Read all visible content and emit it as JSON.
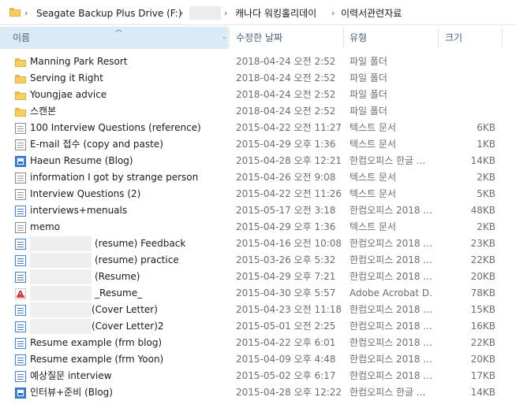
{
  "breadcrumb": {
    "drive": "Seagate Backup Plus Drive (F:)",
    "folder1": "캐나다 워킹홀리데이",
    "folder2": "이력서관련자료"
  },
  "columns": {
    "name": "이름",
    "modified": "수정한 날짜",
    "type": "유형",
    "size": "크기"
  },
  "files": [
    {
      "name": "Manning Park Resort",
      "date": "2018-04-24 오전 2:52",
      "type": "파일 폴더",
      "size": "",
      "icon": "folder-icon",
      "kind": "folder"
    },
    {
      "name": "Serving it Right",
      "date": "2018-04-24 오전 2:52",
      "type": "파일 폴더",
      "size": "",
      "icon": "folder-icon",
      "kind": "folder"
    },
    {
      "name": "Youngjae advice",
      "date": "2018-04-24 오전 2:52",
      "type": "파일 폴더",
      "size": "",
      "icon": "folder-icon",
      "kind": "folder"
    },
    {
      "name": "스캔본",
      "date": "2018-04-24 오전 2:52",
      "type": "파일 폴더",
      "size": "",
      "icon": "folder-icon",
      "kind": "folder"
    },
    {
      "name": "100 Interview Questions (reference)",
      "date": "2015-04-22 오전 11:27",
      "type": "텍스트 문서",
      "size": "6KB",
      "icon": "text-file-icon",
      "kind": "text"
    },
    {
      "name": "E-mail 접수 (copy and paste)",
      "date": "2015-04-29 오후 1:36",
      "type": "텍스트 문서",
      "size": "1KB",
      "icon": "text-file-icon",
      "kind": "text"
    },
    {
      "name": "Haeun Resume (Blog)",
      "date": "2015-04-28 오후 12:21",
      "type": "한컴오피스 한글 ...",
      "size": "14KB",
      "icon": "hwp-image-file-icon",
      "kind": "hwpimg"
    },
    {
      "name": "information I got by strange person",
      "date": "2015-04-26 오전 9:08",
      "type": "텍스트 문서",
      "size": "2KB",
      "icon": "text-file-icon",
      "kind": "text"
    },
    {
      "name": "Interview Questions (2)",
      "date": "2015-04-22 오전 11:26",
      "type": "텍스트 문서",
      "size": "5KB",
      "icon": "text-file-icon",
      "kind": "text"
    },
    {
      "name": "interviews+menuals",
      "date": "2015-05-17 오전 3:18",
      "type": "한컴오피스 2018 ...",
      "size": "48KB",
      "icon": "hwp-file-icon",
      "kind": "hwp"
    },
    {
      "name": "memo",
      "date": "2015-04-29 오후 1:36",
      "type": "텍스트 문서",
      "size": "2KB",
      "icon": "text-file-icon",
      "kind": "text"
    },
    {
      "name": "(resume) Feedback",
      "date": "2015-04-16 오전 10:08",
      "type": "한컴오피스 2018 ...",
      "size": "23KB",
      "icon": "hwp-file-icon",
      "kind": "hwp",
      "redacted": true
    },
    {
      "name": "(resume) practice",
      "date": "2015-03-26 오후 5:32",
      "type": "한컴오피스 2018 ...",
      "size": "22KB",
      "icon": "hwp-file-icon",
      "kind": "hwp",
      "redacted": true
    },
    {
      "name": "(Resume)",
      "date": "2015-04-29 오후 7:21",
      "type": "한컴오피스 2018 ...",
      "size": "20KB",
      "icon": "hwp-file-icon",
      "kind": "hwp",
      "redacted": true
    },
    {
      "name": "_Resume_",
      "date": "2015-04-30 오후 5:57",
      "type": "Adobe Acrobat D...",
      "size": "78KB",
      "icon": "pdf-file-icon",
      "kind": "pdf",
      "redacted": true
    },
    {
      "name": "(Cover Letter)",
      "date": "2015-04-23 오전 11:18",
      "type": "한컴오피스 2018 ...",
      "size": "15KB",
      "icon": "hwp-file-icon",
      "kind": "hwp",
      "redacted": true
    },
    {
      "name": "(Cover Letter)2",
      "date": "2015-05-01 오전 2:25",
      "type": "한컴오피스 2018 ...",
      "size": "16KB",
      "icon": "hwp-file-icon",
      "kind": "hwp",
      "redacted": true
    },
    {
      "name": "Resume example (frm blog)",
      "date": "2015-04-22 오후 6:01",
      "type": "한컴오피스 2018 ...",
      "size": "22KB",
      "icon": "hwp-file-icon",
      "kind": "hwp"
    },
    {
      "name": "Resume example (frm Yoon)",
      "date": "2015-04-09 오후 4:48",
      "type": "한컴오피스 2018 ...",
      "size": "20KB",
      "icon": "hwp-file-icon",
      "kind": "hwp"
    },
    {
      "name": "예상질문 interview",
      "date": "2015-05-02 오후 6:17",
      "type": "한컴오피스 2018 ...",
      "size": "17KB",
      "icon": "hwp-file-icon",
      "kind": "hwp"
    },
    {
      "name": "인터뷰+준비 (Blog)",
      "date": "2015-04-28 오후 12:22",
      "type": "한컴오피스 한글 ...",
      "size": "14KB",
      "icon": "hwp-image-file-icon",
      "kind": "hwpimg"
    }
  ]
}
